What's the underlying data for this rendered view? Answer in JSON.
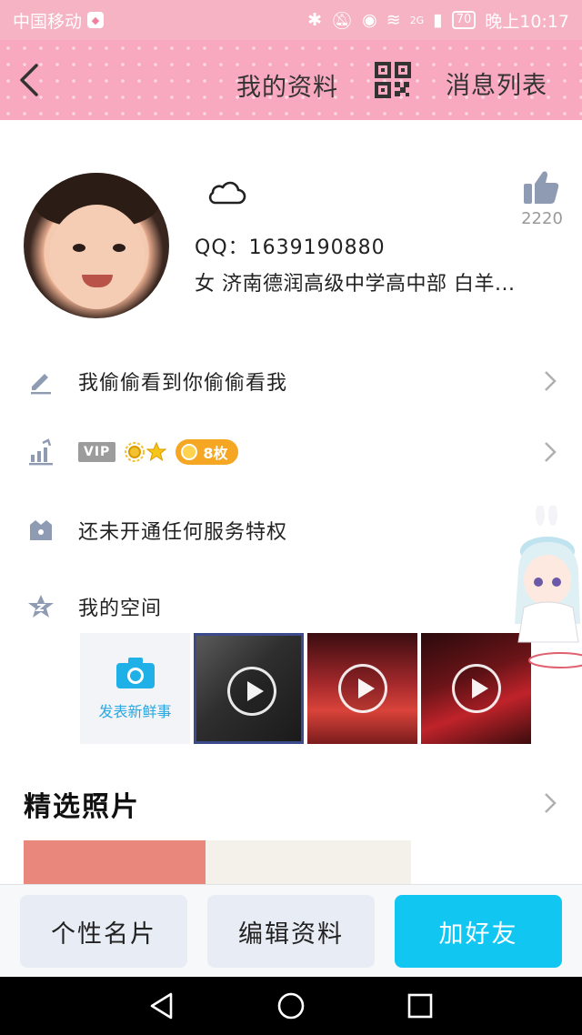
{
  "status_bar": {
    "carrier": "中国移动",
    "network": "2G",
    "battery": "70",
    "time": "晚上10:17"
  },
  "header": {
    "title": "我的资料",
    "right_link": "消息列表"
  },
  "profile": {
    "qq": "QQ：1639190880",
    "info": "女  济南德润高级中学高中部  白羊...",
    "likes": "2220"
  },
  "rows": {
    "signature": "我偷偷看到你偷偷看我",
    "vip_tag": "VIP",
    "coins": "8枚",
    "service": "还未开通任何服务特权",
    "space": "我的空间"
  },
  "space": {
    "post_label": "发表新鲜事"
  },
  "featured": {
    "title": "精选照片"
  },
  "bottom": {
    "card": "个性名片",
    "edit": "编辑资料",
    "add_friend": "加好友"
  },
  "colors": {
    "header_pink": "#f8a9bf",
    "accent_blue": "#12c6f2",
    "coin_orange": "#f5a623"
  },
  "icons": [
    "back-icon",
    "qr-code-icon",
    "cloud-icon",
    "thumbs-up-icon",
    "pencil-icon",
    "chart-up-icon",
    "crown-box-icon",
    "star-space-icon",
    "camera-icon",
    "play-icon",
    "chevron-right-icon"
  ]
}
